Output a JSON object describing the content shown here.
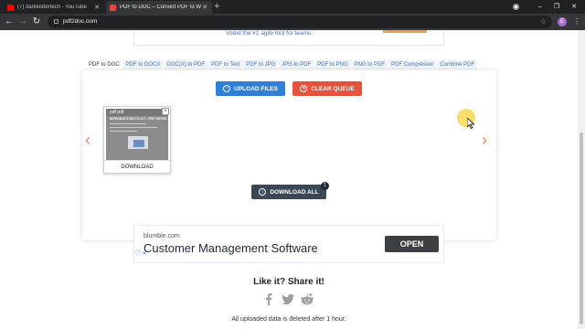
{
  "browser": {
    "tabs": [
      {
        "title": "(7) darkkodertech - YouTube",
        "active": false,
        "favicon": "youtube-icon"
      },
      {
        "title": "PDF to DOC – Convert PDF to W",
        "active": true,
        "favicon": "pdf2doc-icon"
      }
    ],
    "new_tab_glyph": "+",
    "url": "pdf2doc.com",
    "profile_initial": "E",
    "window_controls": {
      "minimize": "–",
      "restore": "❐",
      "close": "✕"
    },
    "nav": {
      "back": "←",
      "forward": "→",
      "reload": "↻"
    }
  },
  "top_banner": {
    "text": "Voted the #1 agile tool for teams"
  },
  "tool_tabs": [
    {
      "label": "PDF to DOC",
      "active": true
    },
    {
      "label": "PDF to DOCX",
      "active": false
    },
    {
      "label": "DOC(X) to PDF",
      "active": false
    },
    {
      "label": "PDF to Text",
      "active": false
    },
    {
      "label": "PDF to JPG",
      "active": false
    },
    {
      "label": "JPG to PDF",
      "active": false
    },
    {
      "label": "PDF to PNG",
      "active": false
    },
    {
      "label": "PNG to PDF",
      "active": false
    },
    {
      "label": "PDF Compressor",
      "active": false
    },
    {
      "label": "Combine PDF",
      "active": false
    }
  ],
  "converter": {
    "upload_label": "UPLOAD FILES",
    "clear_label": "CLEAR QUEUE",
    "prev_arrow": "‹",
    "next_arrow": "›",
    "file": {
      "thumb_logo": "pdf pdf",
      "thumb_title": "INTRODUCTION TO ICT - PDF NOTES",
      "download_label": "DOWNLOAD",
      "close_glyph": "×"
    },
    "download_all_label": "DOWNLOAD ALL",
    "download_all_count": "1"
  },
  "ad": {
    "domain": "blumble.com",
    "headline": "Customer Management Software",
    "cta": "OPEN",
    "choices_glyph": "ⓘ ✕"
  },
  "share": {
    "title": "Like it? Share it!",
    "icons": [
      "facebook-icon",
      "twitter-icon",
      "reddit-icon"
    ]
  },
  "footer_note": "All uploaded data is deleted after 1 hour.",
  "colors": {
    "upload": "#2f80d8",
    "clear": "#e5533c",
    "download_all": "#3b4656",
    "arrows": "#e8865f",
    "tab_text": "#4a6fa5"
  }
}
